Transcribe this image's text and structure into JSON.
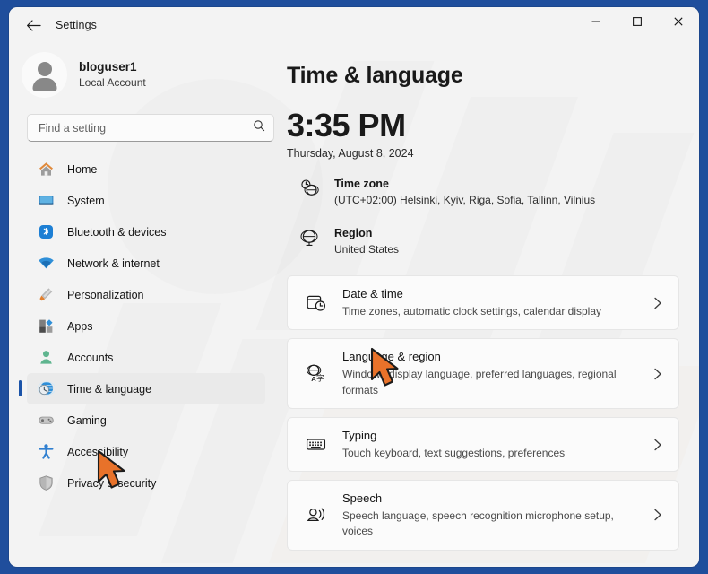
{
  "window": {
    "app_title": "Settings",
    "back_icon": "back-arrow-icon",
    "minimize_label": "Minimize",
    "maximize_label": "Maximize",
    "close_label": "Close",
    "accent_color": "#1b53a8",
    "desktop_color": "#1f4e9c",
    "cursor_color": "#e8722a"
  },
  "account": {
    "name": "bloguser1",
    "type": "Local Account",
    "avatar_icon": "person-avatar-icon"
  },
  "search": {
    "placeholder": "Find a setting",
    "value": "",
    "icon": "search-icon"
  },
  "sidebar": {
    "items": [
      {
        "label": "Home",
        "icon": "home-icon",
        "selected": false
      },
      {
        "label": "System",
        "icon": "monitor-icon",
        "selected": false
      },
      {
        "label": "Bluetooth & devices",
        "icon": "bluetooth-icon",
        "selected": false
      },
      {
        "label": "Network & internet",
        "icon": "wifi-icon",
        "selected": false
      },
      {
        "label": "Personalization",
        "icon": "paintbrush-icon",
        "selected": false
      },
      {
        "label": "Apps",
        "icon": "apps-blocks-icon",
        "selected": false
      },
      {
        "label": "Accounts",
        "icon": "person-icon",
        "selected": false
      },
      {
        "label": "Time & language",
        "icon": "globe-clock-icon",
        "selected": true
      },
      {
        "label": "Gaming",
        "icon": "gamepad-icon",
        "selected": false
      },
      {
        "label": "Accessibility",
        "icon": "accessibility-icon",
        "selected": false
      },
      {
        "label": "Privacy & security",
        "icon": "shield-icon",
        "selected": false
      }
    ]
  },
  "main": {
    "page_title": "Time & language",
    "clock": "3:35 PM",
    "date": "Thursday, August 8, 2024",
    "info_rows": [
      {
        "title": "Time zone",
        "subtitle": "(UTC+02:00) Helsinki, Kyiv, Riga, Sofia, Tallinn, Vilnius",
        "icon": "clock-globe-icon"
      },
      {
        "title": "Region",
        "subtitle": "United States",
        "icon": "globe-icon"
      }
    ],
    "cards": [
      {
        "title": "Date & time",
        "subtitle": "Time zones, automatic clock settings, calendar display",
        "icon": "calendar-clock-icon",
        "chevron": "chevron-right-icon"
      },
      {
        "title": "Language & region",
        "subtitle": "Windows display language, preferred languages, regional formats",
        "icon": "language-globe-icon",
        "chevron": "chevron-right-icon"
      },
      {
        "title": "Typing",
        "subtitle": "Touch keyboard, text suggestions, preferences",
        "icon": "keyboard-icon",
        "chevron": "chevron-right-icon"
      },
      {
        "title": "Speech",
        "subtitle": "Speech language, speech recognition microphone setup, voices",
        "icon": "speech-icon",
        "chevron": "chevron-right-icon"
      }
    ]
  },
  "annotations": [
    {
      "name": "cursor-pointing-date-time",
      "icon": "orange-cursor-icon"
    },
    {
      "name": "cursor-pointing-time-language",
      "icon": "orange-cursor-icon"
    }
  ]
}
